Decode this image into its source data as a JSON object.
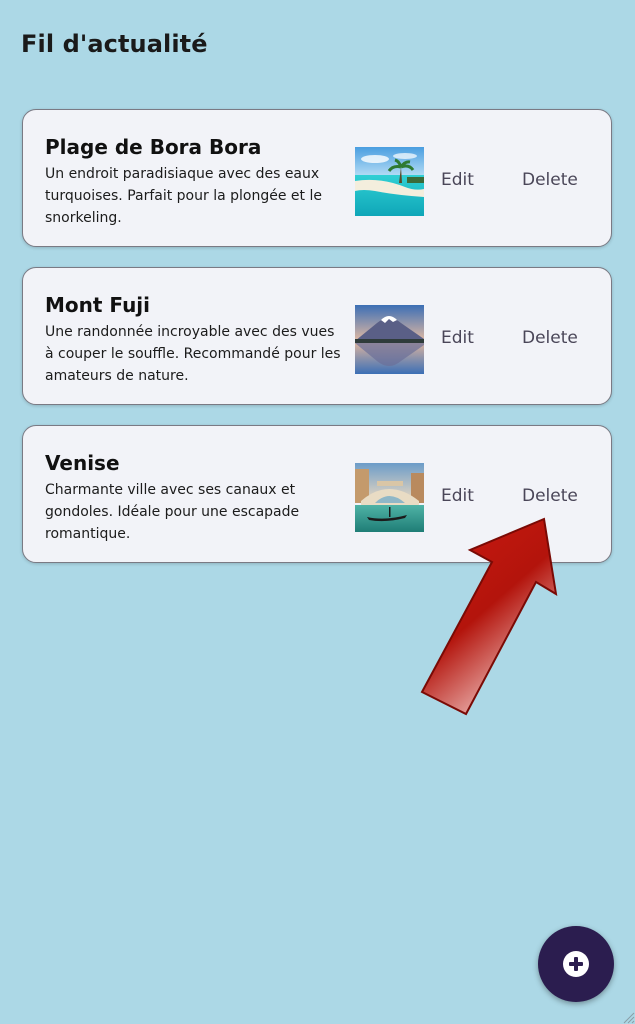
{
  "header": {
    "title": "Fil d'actualité"
  },
  "feed": {
    "items": [
      {
        "title": "Plage de Bora Bora",
        "description": "Un endroit paradisiaque avec des eaux turquoises. Parfait pour la plongée et le snorkeling.",
        "image": "beach-photo",
        "edit_label": "Edit",
        "delete_label": "Delete"
      },
      {
        "title": "Mont Fuji",
        "description": "Une randonnée incroyable avec des vues à couper le souffle. Recommandé pour les amateurs de nature.",
        "image": "mountain-photo",
        "edit_label": "Edit",
        "delete_label": "Delete"
      },
      {
        "title": "Venise",
        "description": "Charmante ville avec ses canaux et gondoles. Idéale pour une escapade romantique.",
        "image": "venice-photo",
        "edit_label": "Edit",
        "delete_label": "Delete"
      }
    ]
  },
  "fab": {
    "icon": "add-circle-icon"
  },
  "annotation": {
    "icon": "red-arrow-pointer",
    "color": "#c0150e"
  },
  "colors": {
    "background": "#acd8e6",
    "card_background": "#f2f3f8",
    "fab_background": "#2b1d4f"
  }
}
